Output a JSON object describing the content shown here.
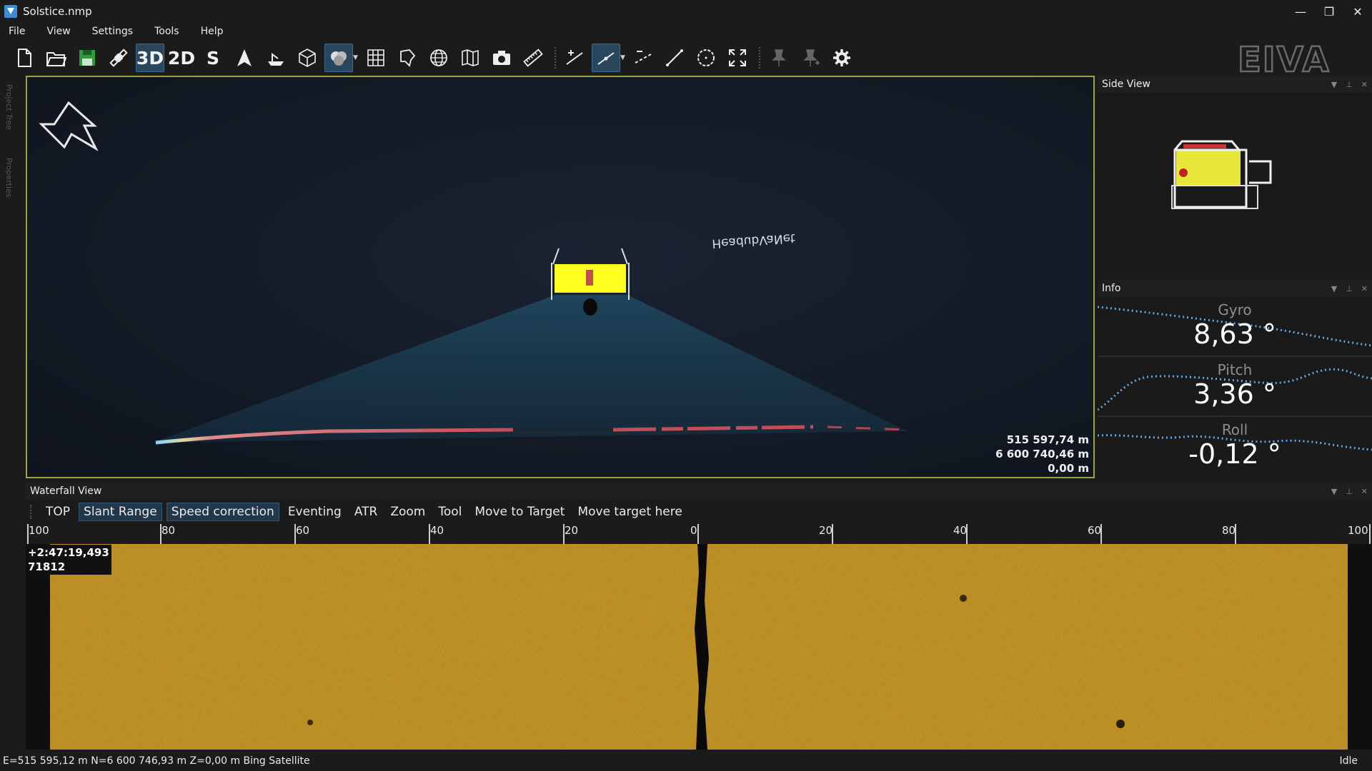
{
  "window": {
    "title": "Solstice.nmp",
    "minimize": "—",
    "maximize": "❐",
    "close": "✕"
  },
  "menu": [
    "File",
    "View",
    "Settings",
    "Tools",
    "Help"
  ],
  "toolbar": {
    "mode_3d": "3D",
    "mode_2d": "2D",
    "mode_s": "S",
    "brand": "EIVA"
  },
  "left_dock": {
    "tab1": "Project Tree",
    "tab2": "Properties"
  },
  "view3d": {
    "label": "HeadubVaNet",
    "coords": [
      "515 597,74 m",
      "6 600 740,46 m",
      "0,00 m"
    ]
  },
  "side_view": {
    "title": "Side View"
  },
  "info": {
    "title": "Info",
    "gauges": [
      {
        "label": "Gyro",
        "value": "8,63 °"
      },
      {
        "label": "Pitch",
        "value": "3,36 °"
      },
      {
        "label": "Roll",
        "value": "-0,12 °"
      }
    ]
  },
  "waterfall": {
    "title": "Waterfall View",
    "buttons": [
      {
        "label": "TOP",
        "on": false
      },
      {
        "label": "Slant Range",
        "on": true
      },
      {
        "label": "Speed correction",
        "on": true
      },
      {
        "label": "Eventing",
        "on": false
      },
      {
        "label": "ATR",
        "on": false
      },
      {
        "label": "Zoom",
        "on": false
      },
      {
        "label": "Tool",
        "on": false
      },
      {
        "label": "Move to Target",
        "on": false
      },
      {
        "label": "Move target here",
        "on": false
      }
    ],
    "ruler_labels": [
      "100",
      "80",
      "60",
      "40",
      "20",
      "0",
      "20",
      "40",
      "60",
      "80",
      "100"
    ],
    "time_stamp": "+2:47:19,493",
    "ping": "71812"
  },
  "status": {
    "text": "E=515 595,12 m N=6 600 746,93 m Z=0,00 m Bing Satellite",
    "state": "Idle"
  },
  "colors": {
    "accent_frame": "#9aa63a",
    "active_button": "#28475f",
    "sonar": "#b8861a",
    "trace": "#5fa8e8"
  }
}
